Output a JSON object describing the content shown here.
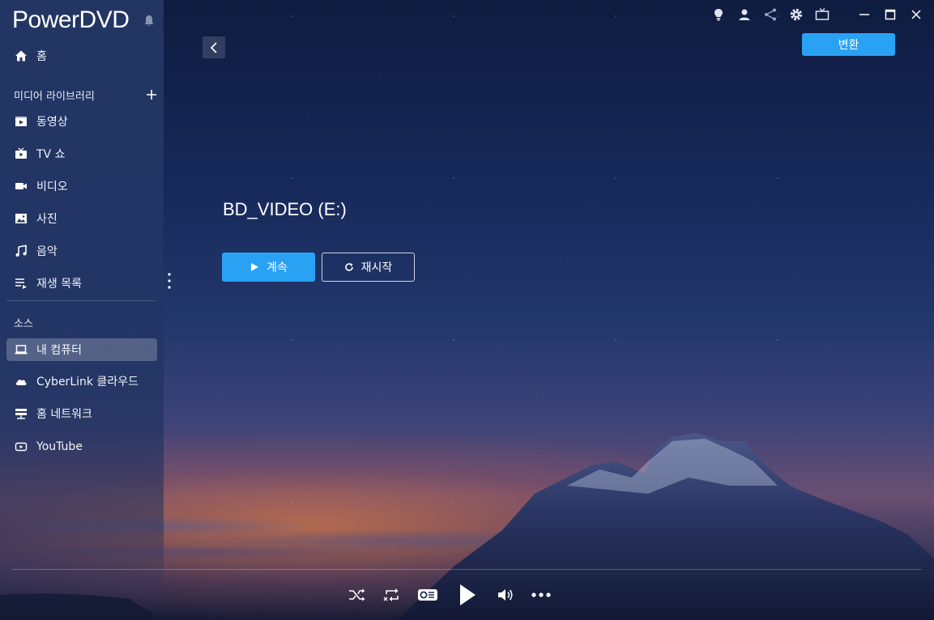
{
  "app": {
    "title": "PowerDVD"
  },
  "sidebar": {
    "home_label": "홈",
    "media_library_header": "미디어 라이브러리",
    "media_items": [
      {
        "label": "동영상",
        "icon": "movie-icon"
      },
      {
        "label": "TV 쇼",
        "icon": "tv-show-icon"
      },
      {
        "label": "비디오",
        "icon": "video-camera-icon"
      },
      {
        "label": "사진",
        "icon": "photo-icon"
      },
      {
        "label": "음악",
        "icon": "music-note-icon"
      },
      {
        "label": "재생 목록",
        "icon": "playlist-icon"
      }
    ],
    "source_header": "소스",
    "source_items": [
      {
        "label": "내 컴퓨터",
        "icon": "laptop-icon",
        "active": true
      },
      {
        "label": "CyberLink 클라우드",
        "icon": "cloud-icon"
      },
      {
        "label": "홈 네트워크",
        "icon": "network-icon"
      },
      {
        "label": "YouTube",
        "icon": "youtube-icon"
      }
    ]
  },
  "header": {
    "convert_label": "변환",
    "icons": [
      "lightbulb-icon",
      "user-icon",
      "share-icon",
      "gear-icon",
      "tv-mode-icon",
      "minimize-icon",
      "maximize-icon",
      "close-icon"
    ]
  },
  "main": {
    "disc_title": "BD_VIDEO (E:)",
    "resume_label": "계속",
    "restart_label": "재시작"
  },
  "player": {
    "controls": [
      "shuffle-icon",
      "repeat-icon",
      "subtitle-icon",
      "play-icon",
      "volume-icon",
      "more-icon"
    ]
  },
  "colors": {
    "accent": "#2aa2f4",
    "sidebar_bg": "#263a68"
  }
}
